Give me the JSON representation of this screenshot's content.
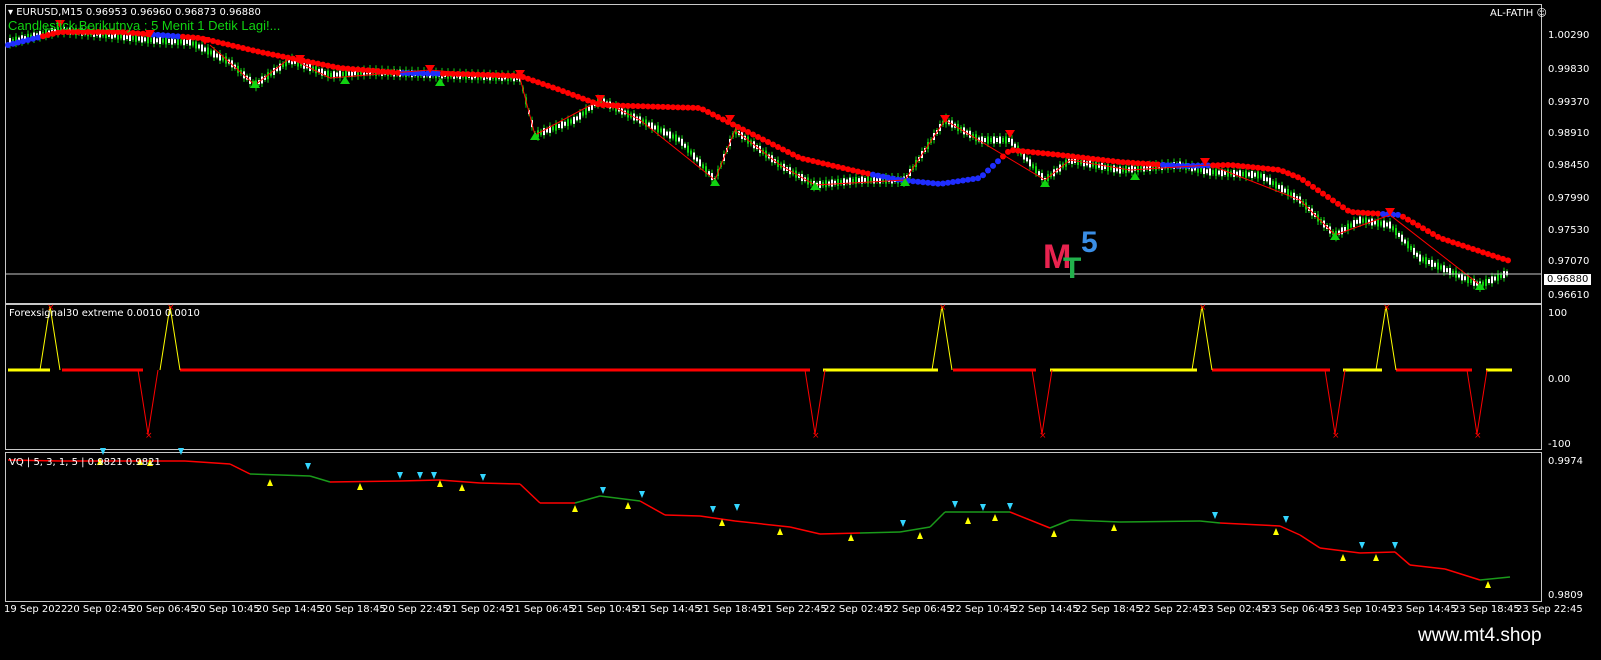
{
  "chart": {
    "symbol_title": "EURUSD,M15  0.96953 0.96960 0.96873 0.96880",
    "countdown_text": "Candlestick Berikutnya : 5 Menit 1 Detik Lagi!...",
    "ea_name": "AL-FATIH",
    "price_axis": [
      "1.00290",
      "0.99830",
      "0.99370",
      "0.98910",
      "0.98450",
      "0.97990",
      "0.97530",
      "0.97070",
      "0.96610"
    ],
    "current_price": "0.96880"
  },
  "indicator1": {
    "title": "Forexsignal30 extreme 0.0010 0.0010",
    "axis": [
      "100",
      "0.00",
      "-100"
    ]
  },
  "indicator2": {
    "title": "VQ | 5, 3, 1, 5 | 0.9821 0.9821",
    "axis": [
      "0.9974",
      "0.9809"
    ]
  },
  "time_axis": [
    "19 Sep 2022",
    "20 Sep 02:45",
    "20 Sep 06:45",
    "20 Sep 10:45",
    "20 Sep 14:45",
    "20 Sep 18:45",
    "20 Sep 22:45",
    "21 Sep 02:45",
    "21 Sep 06:45",
    "21 Sep 10:45",
    "21 Sep 14:45",
    "21 Sep 18:45",
    "21 Sep 22:45",
    "22 Sep 02:45",
    "22 Sep 06:45",
    "22 Sep 10:45",
    "22 Sep 14:45",
    "22 Sep 18:45",
    "22 Sep 22:45",
    "23 Sep 02:45",
    "23 Sep 06:45",
    "23 Sep 10:45",
    "23 Sep 14:45",
    "23 Sep 18:45",
    "23 Sep 22:45"
  ],
  "logo": {
    "m": "M",
    "t": "T",
    "five": "5"
  },
  "watermark": "www.mt4.shop",
  "colors": {
    "bull": "#11d311",
    "bear": "#ff0000",
    "blue": "#1f2dff",
    "yellow": "#ffff00",
    "cyan": "#33d6ff",
    "green_line": "#1a9a1a"
  }
}
